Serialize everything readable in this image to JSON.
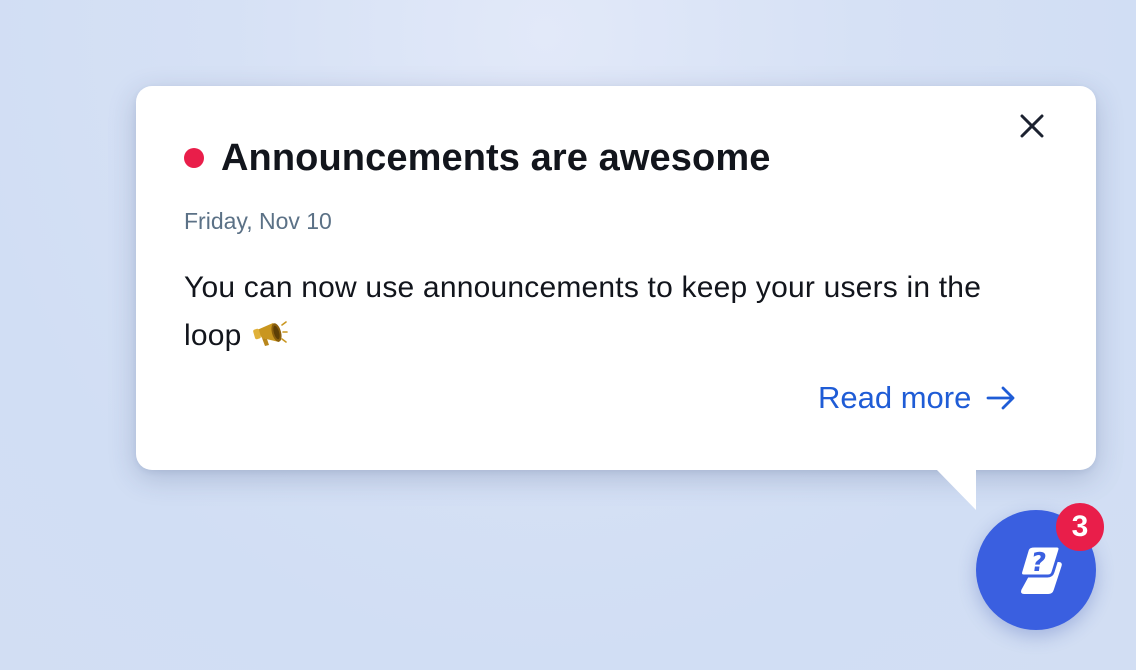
{
  "announcement": {
    "title": "Announcements are awesome",
    "date": "Friday, Nov 10",
    "body": "You can now use announcements to keep your users in the loop",
    "body_emoji_icon": "megaphone-icon",
    "read_more_label": "Read more",
    "read_more_icon": "arrow-right-icon",
    "close_icon": "close-icon",
    "unread_indicator_color": "#e91e4a"
  },
  "launcher": {
    "icon": "help-chat-icon",
    "badge_count": "3",
    "color": "#3a5fe0",
    "badge_color": "#e91e4a"
  },
  "colors": {
    "link": "#1f5cd6",
    "date_text": "#5b7186",
    "text": "#12151c"
  }
}
